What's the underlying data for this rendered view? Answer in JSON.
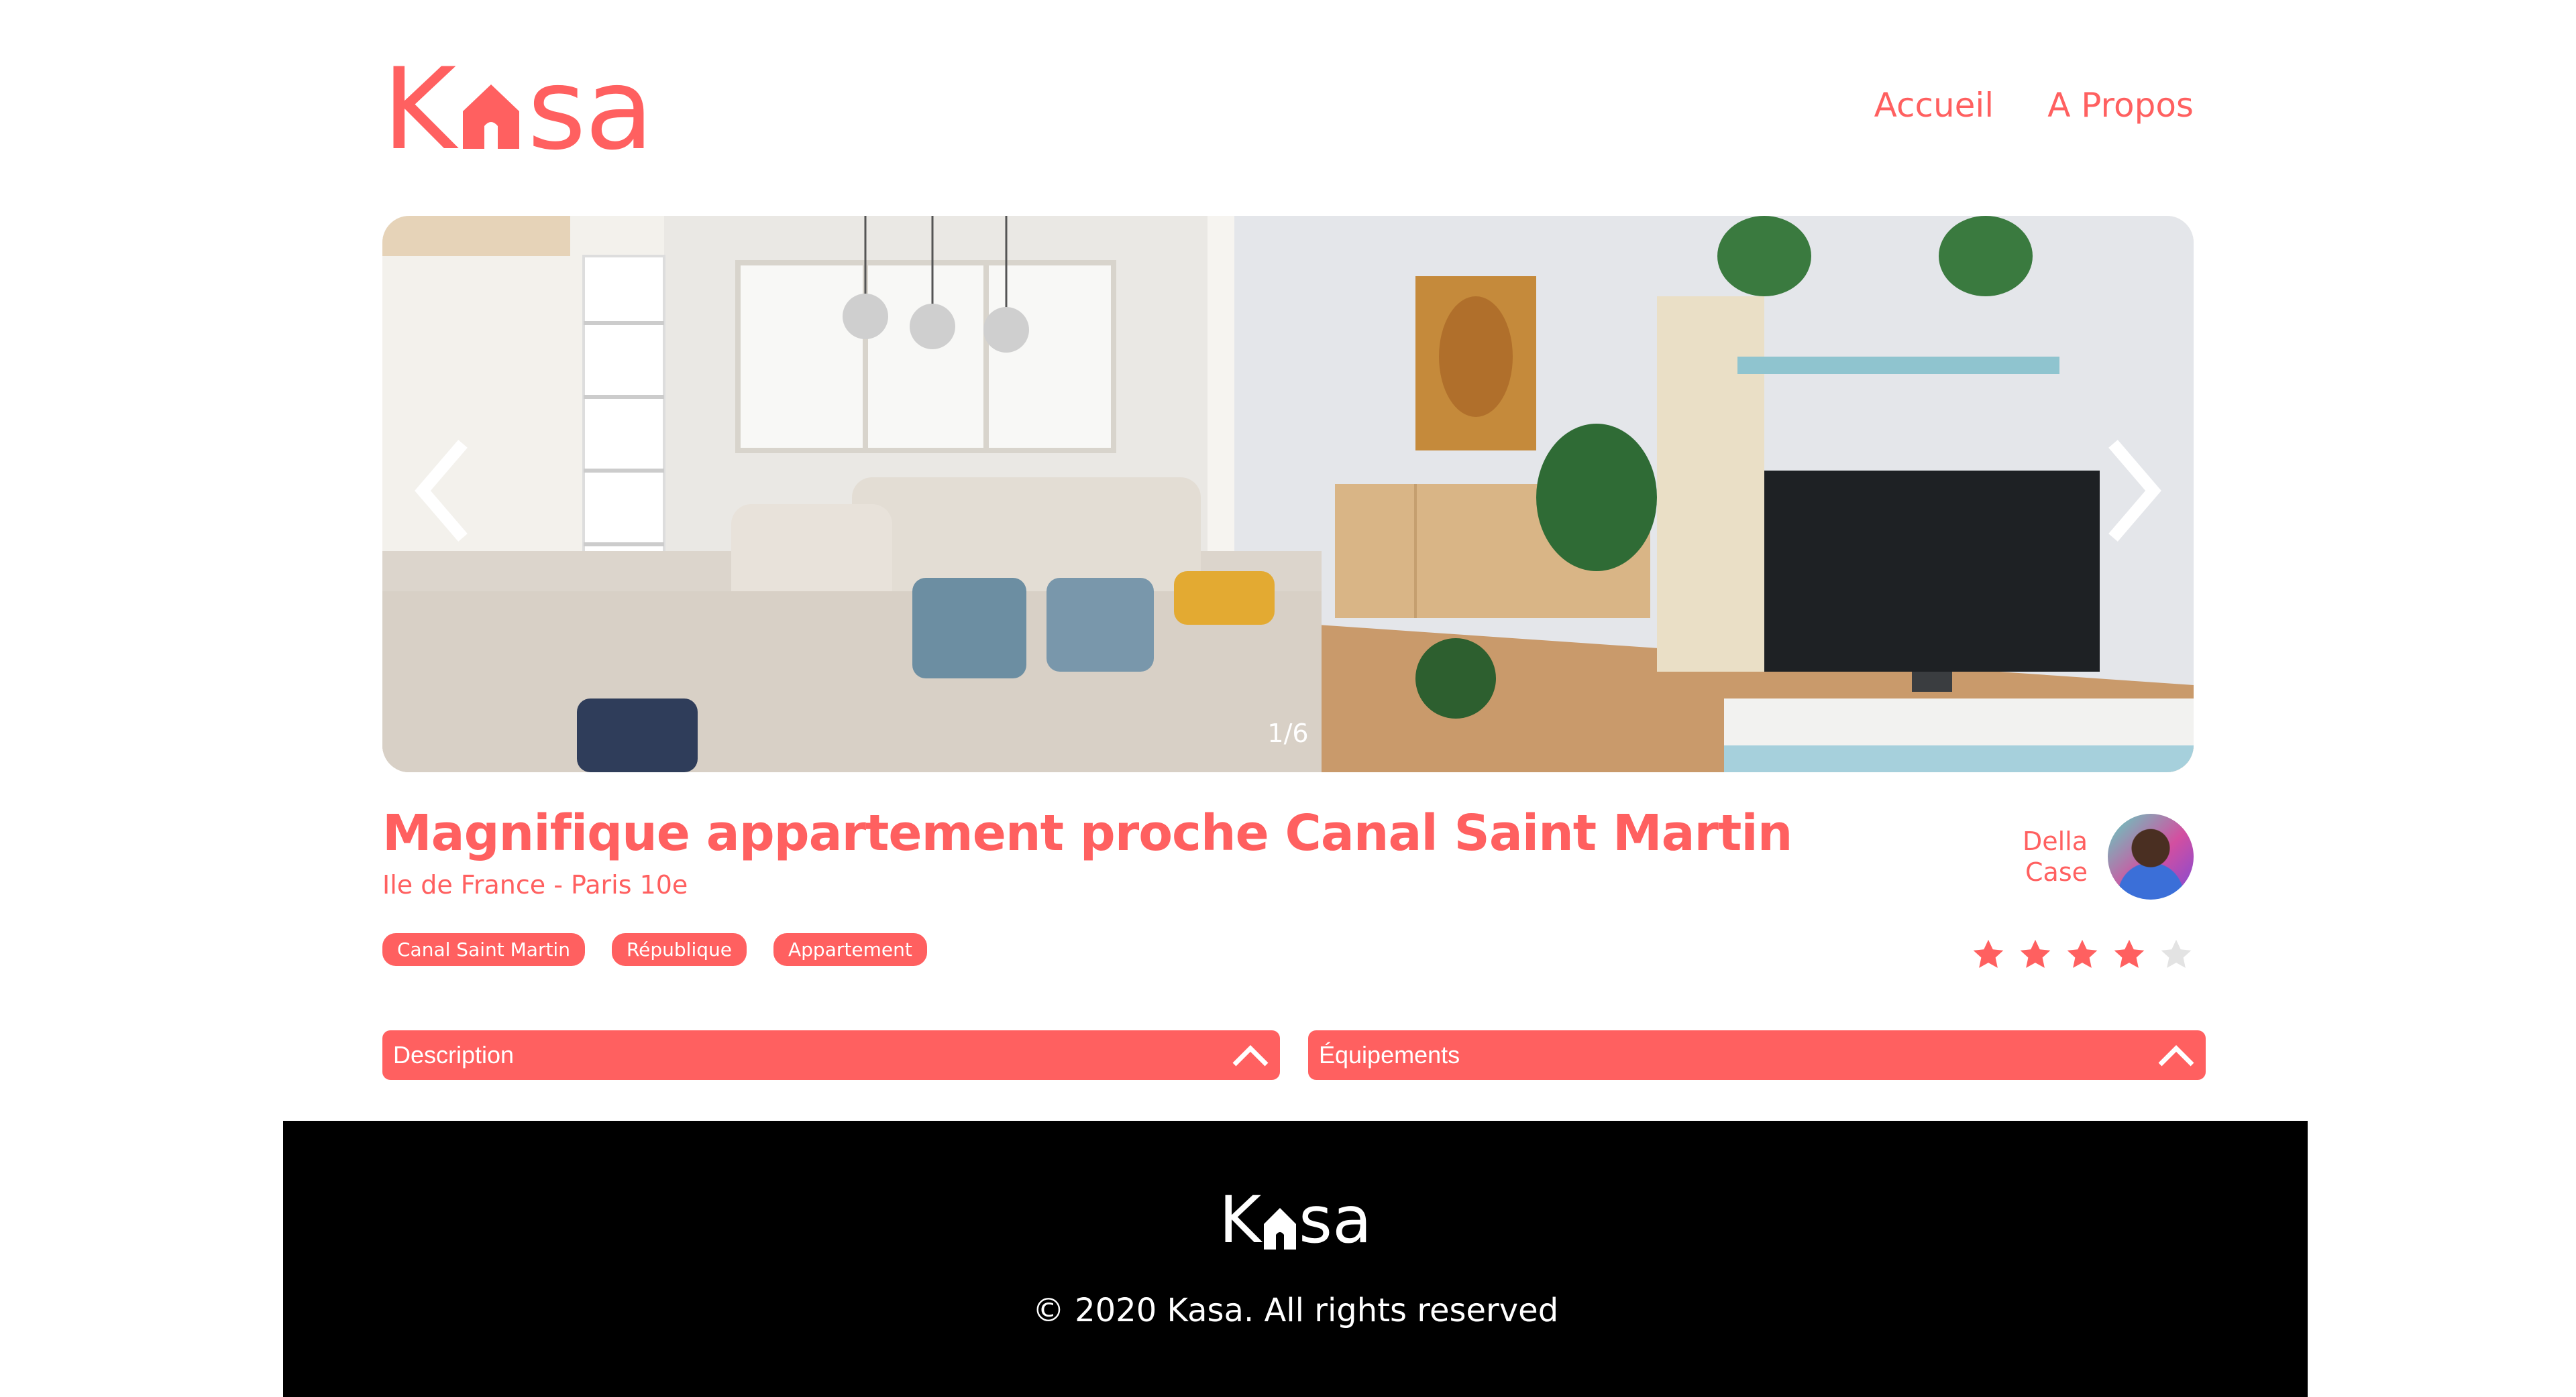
{
  "brand": {
    "logo_part1": "K",
    "logo_part2": "sa",
    "color": "#FF6060"
  },
  "nav": {
    "items": [
      {
        "label": "Accueil"
      },
      {
        "label": "A Propos"
      }
    ]
  },
  "carousel": {
    "counter": "1/6",
    "current": 1,
    "total": 6,
    "icons": {
      "prev": "chevron-left-icon",
      "next": "chevron-right-icon"
    }
  },
  "listing": {
    "title": "Magnifique appartement proche Canal Saint Martin",
    "location": "Ile de France - Paris 10e",
    "tags": [
      "Canal Saint Martin",
      "République",
      "Appartement"
    ],
    "host": {
      "first_name": "Della",
      "last_name": "Case"
    },
    "rating": 4,
    "rating_max": 5
  },
  "collapses": {
    "description_label": "Description",
    "equipments_label": "Équipements"
  },
  "footer": {
    "logo_part1": "K",
    "logo_part2": "sa",
    "copyright": "© 2020 Kasa. All rights reserved"
  },
  "colors": {
    "accent": "#FF6060",
    "star_empty": "#E3E3E3",
    "footer_bg": "#000000"
  }
}
